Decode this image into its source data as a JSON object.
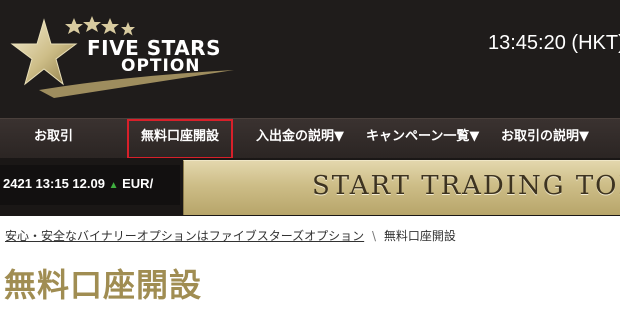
{
  "header": {
    "logo": {
      "line1": "FIVE STARS",
      "line2": "OPTION",
      "icon": "star-logo-icon"
    },
    "clock": "13:45:20 (HKT)"
  },
  "nav": {
    "items": [
      {
        "label": "お取引"
      },
      {
        "label": "無料口座開設",
        "active": true
      },
      {
        "label": "入出金の説明▼"
      },
      {
        "label": "キャンペーン一覧▼"
      },
      {
        "label": "お取引の説明▼"
      }
    ],
    "highlight_color": "#d8202a"
  },
  "ticker": {
    "rate": "2421",
    "time": "13:15",
    "price": "12.09",
    "direction_icon": "up-arrow-icon",
    "pair_partial": "EUR/"
  },
  "banner": {
    "text": "START TRADING TOD"
  },
  "breadcrumb": {
    "home": "安心・安全なバイナリーオプションはファイブスターズオプション",
    "separator": "\\",
    "current": "無料口座開設"
  },
  "page": {
    "title": "無料口座開設"
  },
  "colors": {
    "header_bg": "#1f1c1b",
    "nav_bg": "#2b2523",
    "gold": "#a08d52",
    "banner_gold": "#cdbd87",
    "up_green": "#3fae3f"
  }
}
